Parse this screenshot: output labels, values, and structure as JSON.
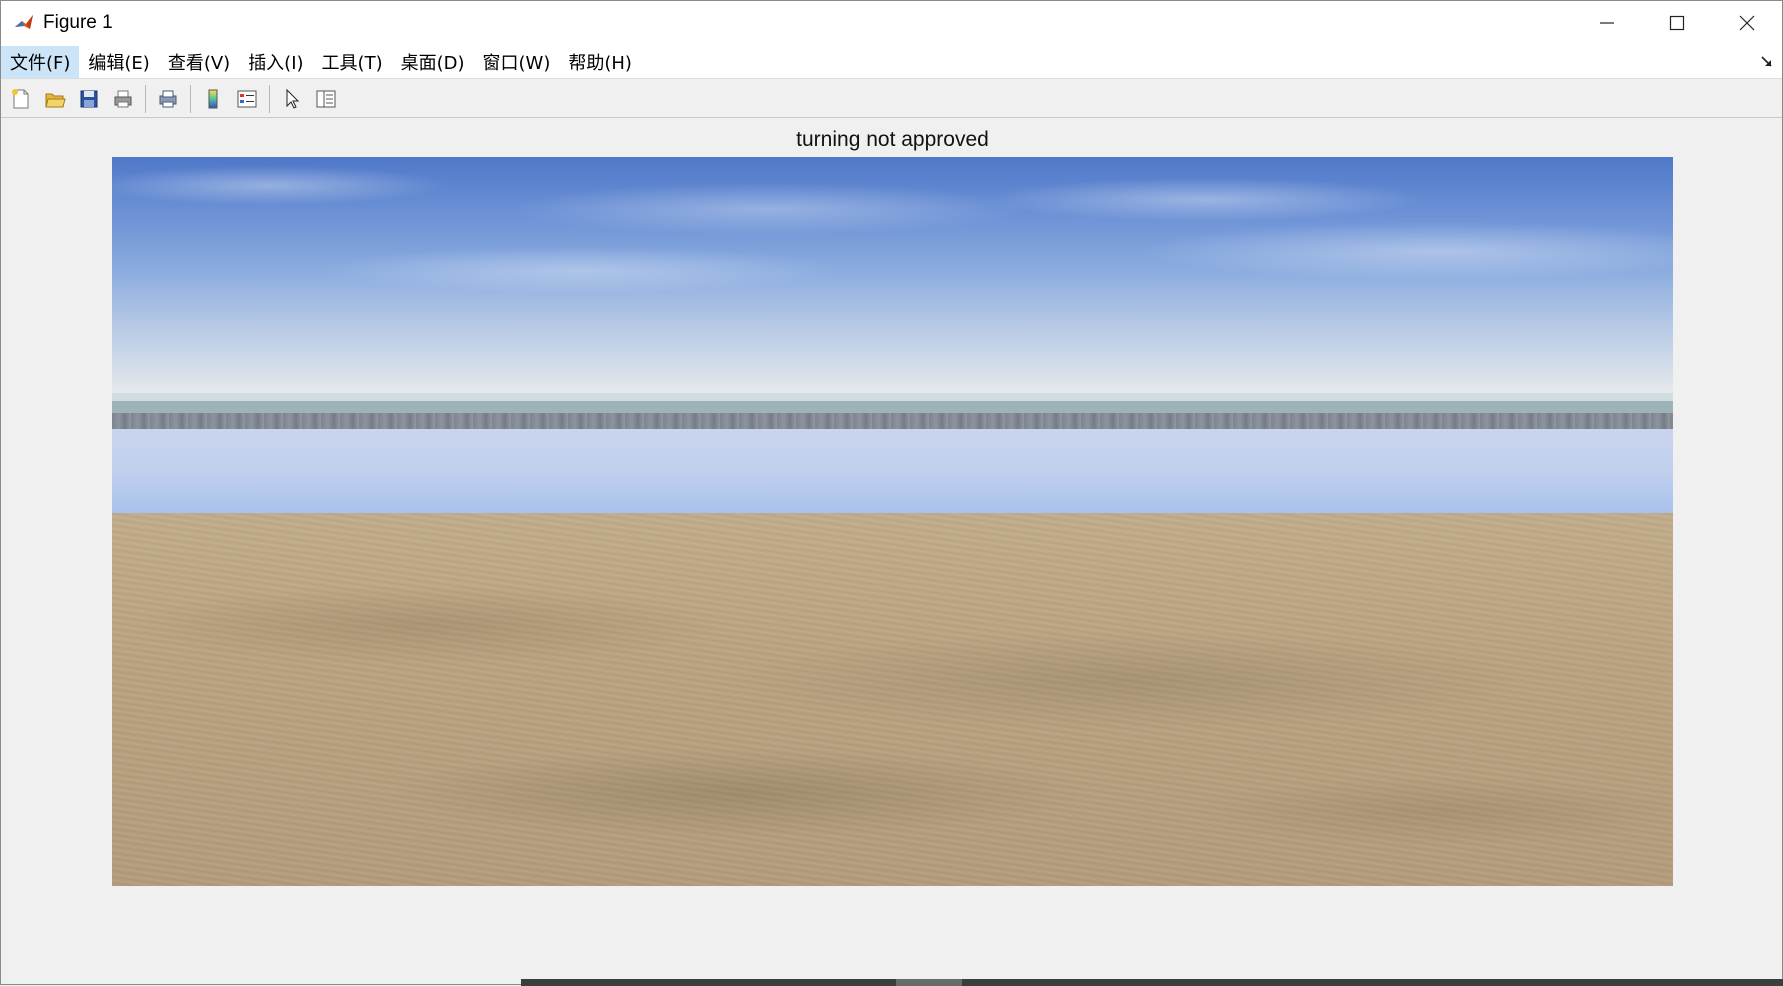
{
  "window": {
    "title": "Figure 1"
  },
  "menu": {
    "items": [
      {
        "label": "文件(F)"
      },
      {
        "label": "编辑(E)"
      },
      {
        "label": "查看(V)"
      },
      {
        "label": "插入(I)"
      },
      {
        "label": "工具(T)"
      },
      {
        "label": "桌面(D)"
      },
      {
        "label": "窗口(W)"
      },
      {
        "label": "帮助(H)"
      }
    ],
    "active_index": 0
  },
  "toolbar": {
    "buttons": [
      "new-figure-icon",
      "open-file-icon",
      "save-icon",
      "print-icon",
      "print-preview-icon",
      "colorbar-icon",
      "legend-icon",
      "edit-plot-pointer-icon",
      "property-inspector-icon"
    ]
  },
  "figure": {
    "axes_title": "turning not approved"
  },
  "colors": {
    "sky_top": "#4f78c9",
    "water": "#c1cfee",
    "ground": "#baa381",
    "menu_active": "#cce4f7"
  }
}
